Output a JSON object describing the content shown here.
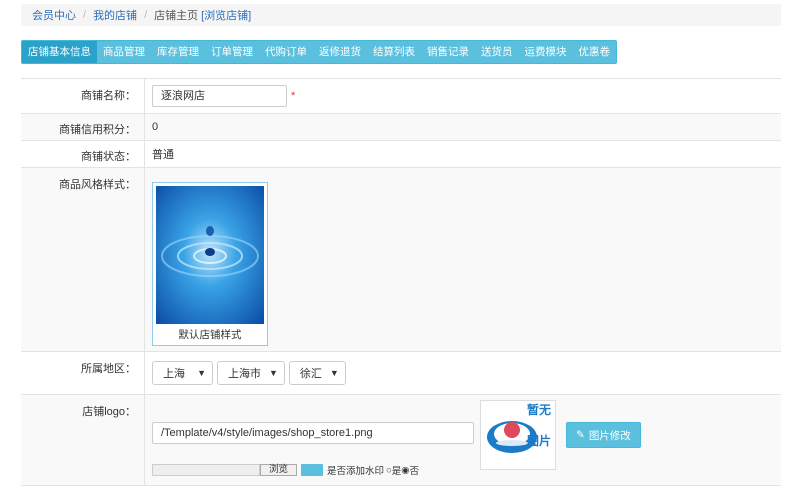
{
  "breadcrumb": {
    "home": "会员中心",
    "store": "我的店铺",
    "current": "店铺主页",
    "browse_link": "[浏览店铺]"
  },
  "tabs": [
    {
      "label": "店铺基本信息",
      "active": true
    },
    {
      "label": "商品管理"
    },
    {
      "label": "库存管理"
    },
    {
      "label": "订单管理"
    },
    {
      "label": "代购订单"
    },
    {
      "label": "返修退货"
    },
    {
      "label": "结算列表"
    },
    {
      "label": "销售记录"
    },
    {
      "label": "送货员"
    },
    {
      "label": "运费模块"
    },
    {
      "label": "优惠卷"
    }
  ],
  "form": {
    "store_name": {
      "label": "商铺名称：",
      "value": "逐浪网店",
      "required_mark": "*"
    },
    "credit": {
      "label": "商铺信用积分：",
      "value": "0"
    },
    "status": {
      "label": "商铺状态：",
      "value": "普通"
    },
    "style": {
      "label": "商品风格样式：",
      "caption": "默认店铺样式"
    },
    "region": {
      "label": "所属地区：",
      "province": "上海",
      "city": "上海市",
      "district": "徐汇"
    },
    "logo": {
      "label": "店铺logo：",
      "path": "/Template/v4/style/images/shop_store1.png",
      "placeholder_text_1": "暂无",
      "placeholder_text_2": "图片",
      "edit_button": "图片修改"
    },
    "upload": {
      "browse": "浏览",
      "watermark": "是否添加水印",
      "yes": "是",
      "no": "否"
    }
  },
  "colors": {
    "accent": "#5bc0de",
    "link": "#2a6ebb",
    "required": "#ee3333"
  }
}
